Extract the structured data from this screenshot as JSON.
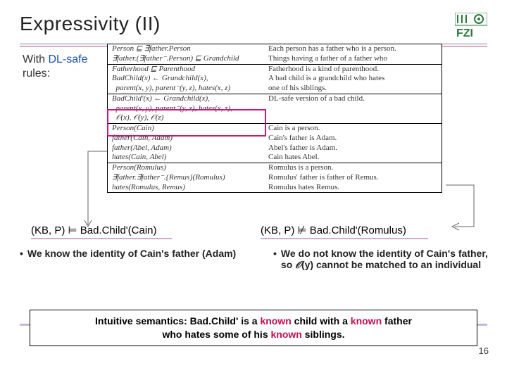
{
  "title": "Expressivity (II)",
  "subtitle_pre": "With ",
  "subtitle_hl": "DL-safe",
  "subtitle_post": " rules:",
  "tbox": {
    "rows": [
      {
        "l": "Person ⊑ ∃father.Person\n∃father.(∃father⁻.Person) ⊑ Grandchild",
        "r": "Each person has a father who is a person.\nThings having a father of a father who"
      },
      {
        "l": "Fatherhood ⊑ Parenthood\nBadChild(x) ← Grandchild(x),\n  parent(x, y), parent⁻(y, z), hates(x, z)",
        "r": "Fatherhood is a kind of parenthood.\nA bad child is a grandchild who hates\none of his siblings."
      },
      {
        "l": "BadChild'(x) ← Grandchild(x),\n  parent(x, y), parent⁻(y, z), hates(x, z),\n  𝒪(x), 𝒪(y), 𝒪(z)",
        "r": "DL-safe version of a bad child."
      },
      {
        "l": "Person(Cain)\nfather(Cain, Adam)\nfather(Abel, Adam)\nhates(Cain, Abel)",
        "r": "Cain is a person.\nCain's father is Adam.\nAbel's father is Adam.\nCain hates Abel."
      },
      {
        "l": "Person(Romulus)\n∃father.∃father⁻.{Remus}(Romulus)\nhates(Romulus, Remus)",
        "r": "Romulus is a person.\nRomulus' father is father of Remus.\nRomulus hates Remus."
      }
    ]
  },
  "entail": {
    "left": "(KB, P) ⊨ Bad.Child'(Cain)",
    "right": "(KB, P) ⊭ Bad.Child'(Romulus)"
  },
  "bullets": {
    "left": "We know the identity of Cain's father (Adam)",
    "right_pre": "We do not know the identity of Cain's father, so ",
    "right_o": "𝒪",
    "right_post": "(y) cannot be matched to an individual"
  },
  "summary": {
    "p1": "Intuitive semantics: Bad.Child' is a ",
    "k1": "known",
    "p2": " child with a ",
    "k2": "known",
    "p3": " father who hates some of his ",
    "k3": "known",
    "p4": " siblings."
  },
  "pagenum": "16",
  "icons": {
    "logo": "fzi-logo"
  }
}
